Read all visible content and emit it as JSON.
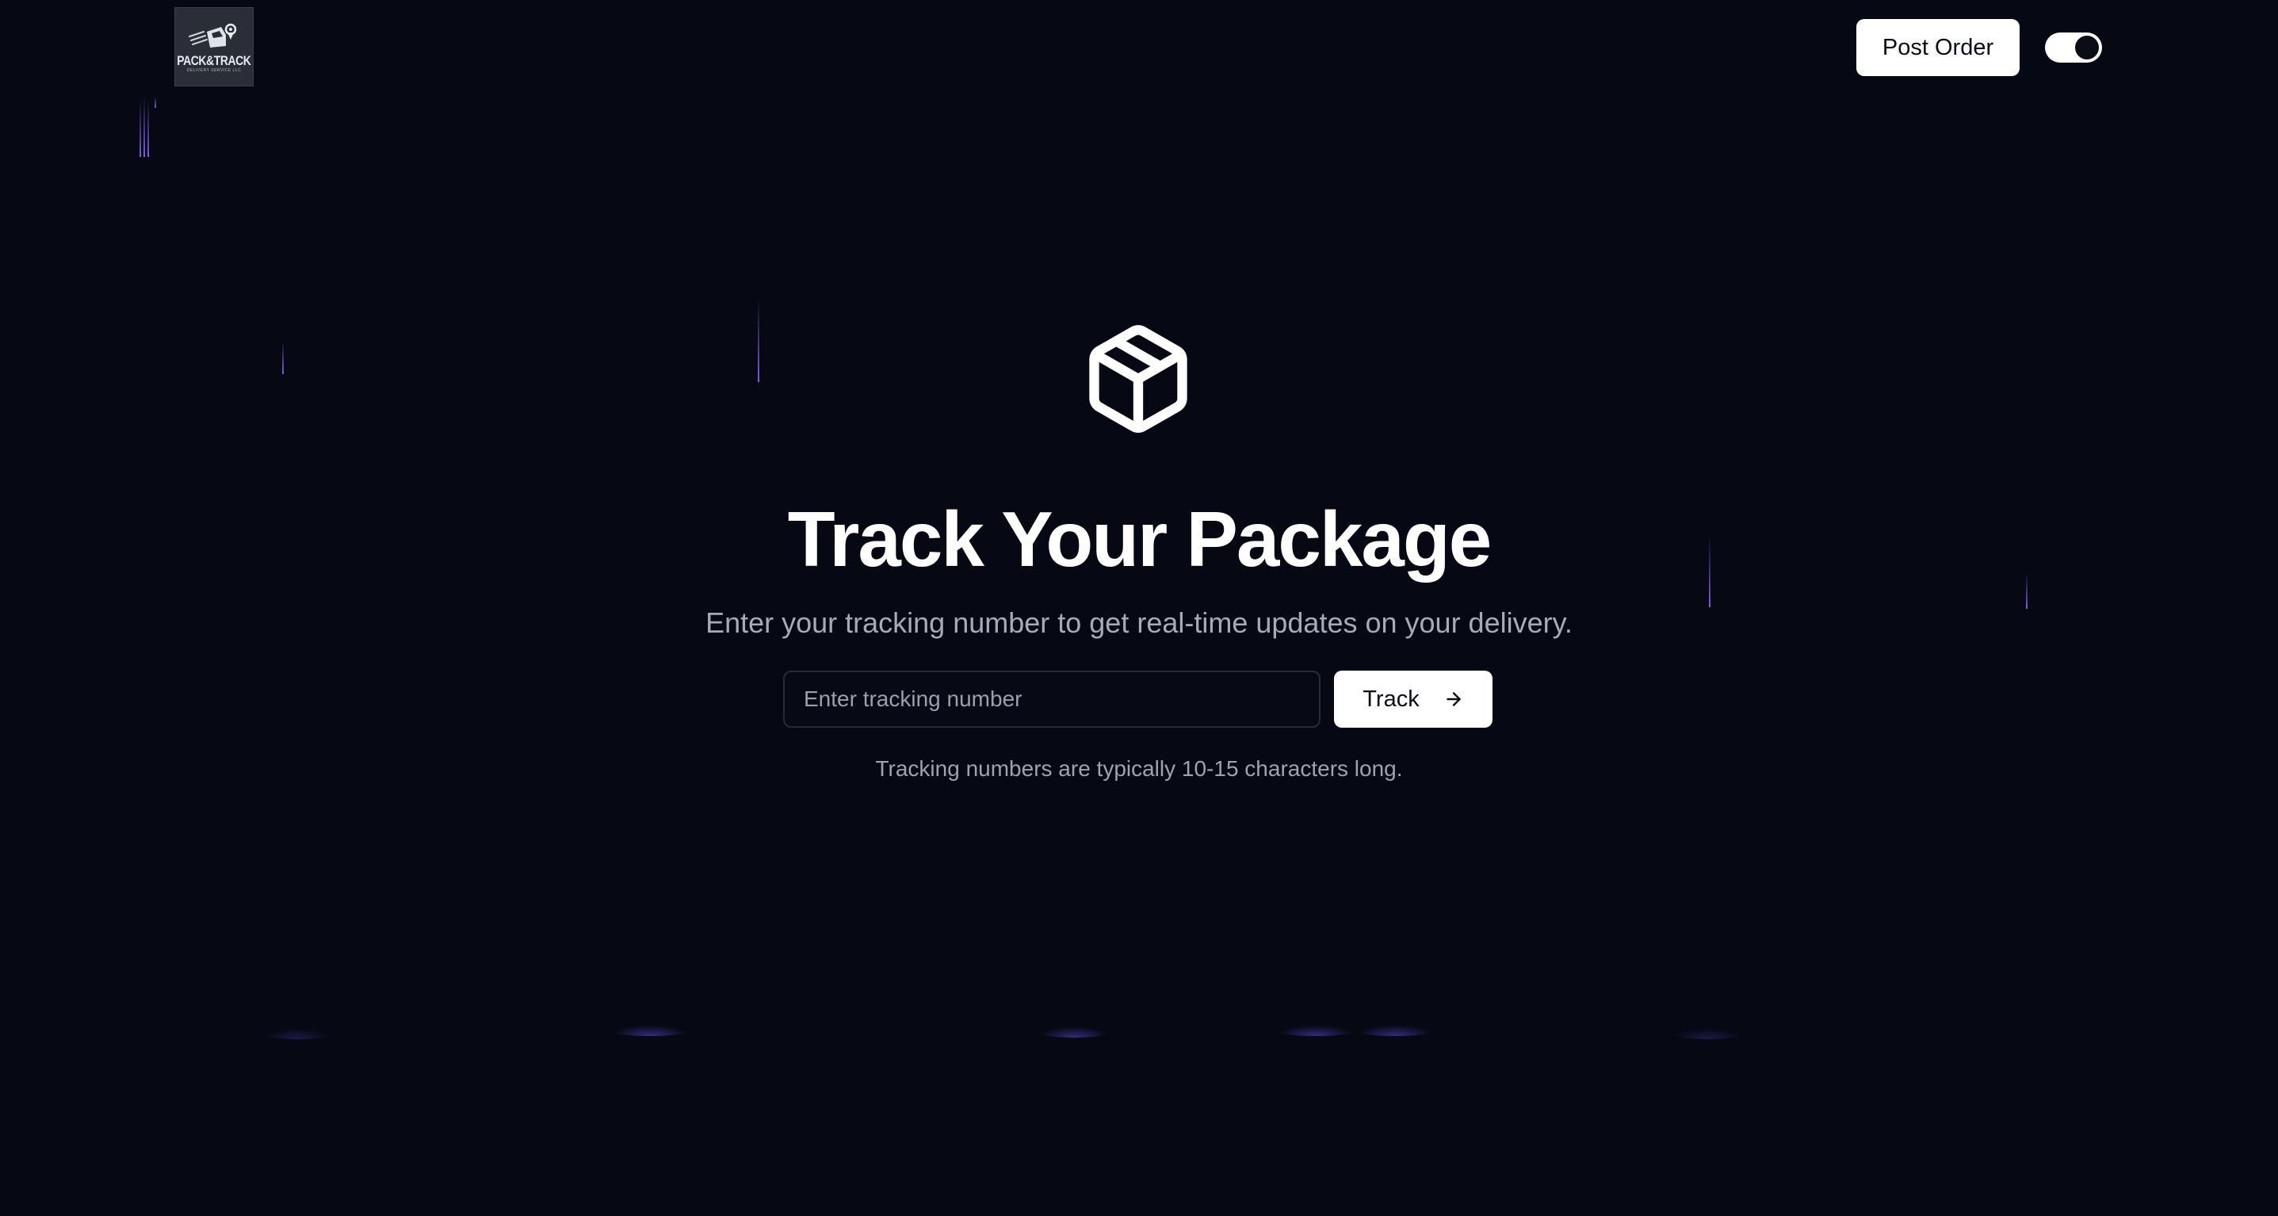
{
  "header": {
    "logo": {
      "icon": "pack-and-track-logo",
      "text": "PACK&TRACK",
      "subtext": "DELIVERY SERVICE LLC"
    },
    "post_order_label": "Post Order",
    "theme_toggle": {
      "state": "on"
    }
  },
  "hero": {
    "icon": "package-icon",
    "title": "Track Your Package",
    "subtitle": "Enter your tracking number to get real-time updates on your delivery."
  },
  "form": {
    "placeholder": "Enter tracking number",
    "value": "",
    "track_label": "Track",
    "track_icon": "arrow-right-icon"
  },
  "hint": "Tracking numbers are typically 10-15 characters long.",
  "colors": {
    "background": "#060813",
    "accent": "#7c5ce6",
    "button": "#ffffff",
    "muted_text": "#a7abb8"
  }
}
